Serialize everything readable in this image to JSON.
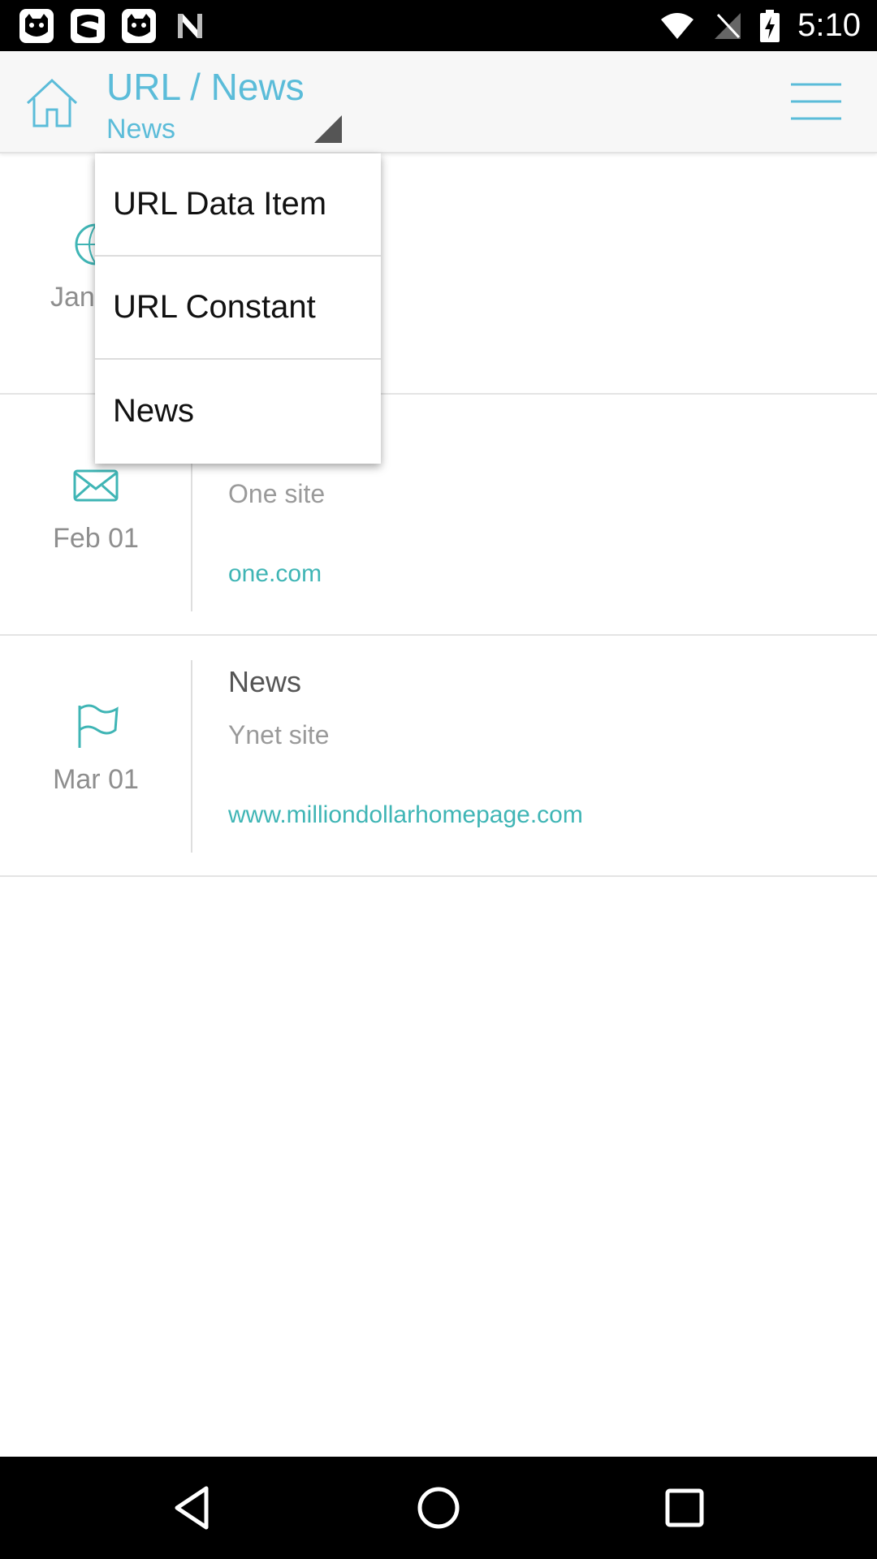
{
  "status_bar": {
    "time": "5:10",
    "notification_icons": [
      "cat-face-icon",
      "cat-face-icon",
      "cat-face-icon",
      "n-logo-icon"
    ],
    "system_icons": [
      "wifi-icon",
      "no-signal-icon",
      "battery-charging-icon"
    ]
  },
  "app_bar": {
    "title": "URL / News",
    "subtitle": "News",
    "accent_color": "#5bbcd9"
  },
  "popup": {
    "options": [
      "URL Data Item",
      "URL Constant",
      "News"
    ]
  },
  "list": {
    "items": [
      {
        "icon": "basketball-icon",
        "date": "Jan",
        "title": "",
        "description": "",
        "link": ""
      },
      {
        "icon": "envelope-icon",
        "date": "Feb 01",
        "title": "",
        "description": "One site",
        "link": "one.com"
      },
      {
        "icon": "flag-icon",
        "date": "Mar 01",
        "title": "News",
        "description": "Ynet site",
        "link": "www.milliondollarhomepage.com"
      }
    ]
  },
  "nav_bar": {
    "buttons": [
      "back-icon",
      "home-circle-icon",
      "recents-icon"
    ]
  }
}
